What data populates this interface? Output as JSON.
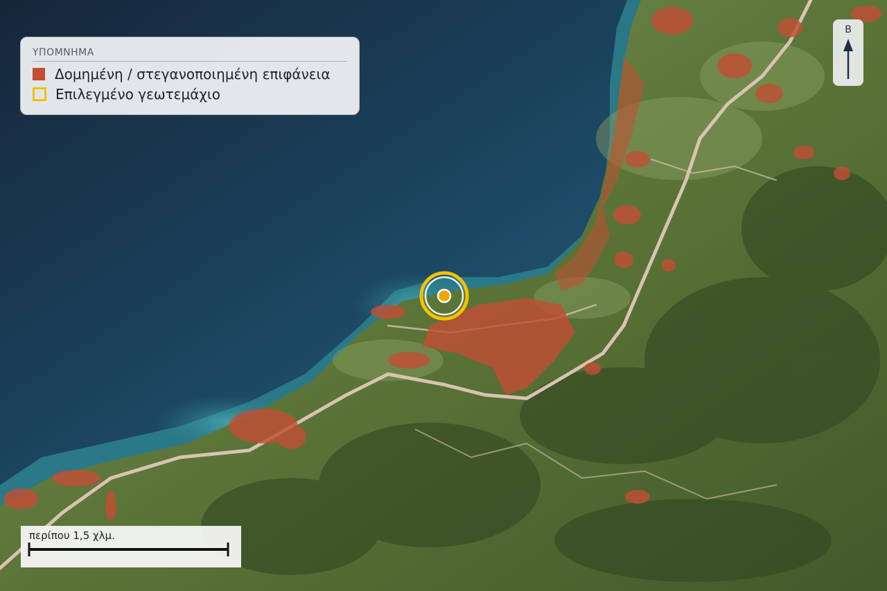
{
  "legend": {
    "title": "ΥΠΟΜΝΗΜΑ",
    "items": [
      {
        "label": "Δομημένη / στεγανοποιημένη επιφάνεια",
        "swatch": "fill",
        "color": "#c24e34"
      },
      {
        "label": "Επιλεγμένο γεωτεμάχιο",
        "swatch": "outline",
        "color": "#f2c200"
      }
    ]
  },
  "north_arrow": {
    "label": "Β",
    "color": "#1d2f45"
  },
  "scale_bar": {
    "label": "περίπου 1,5 χλμ."
  },
  "selected_parcel": {
    "marker_color": "#f2a600",
    "ring_color": "#f2c200"
  },
  "colors": {
    "sea_deep": "#1b3a52",
    "sea_shallow": "#2f8a96",
    "land": "#5f7a3c",
    "built_up": "#c24e34",
    "road": "#d9c3b0"
  }
}
